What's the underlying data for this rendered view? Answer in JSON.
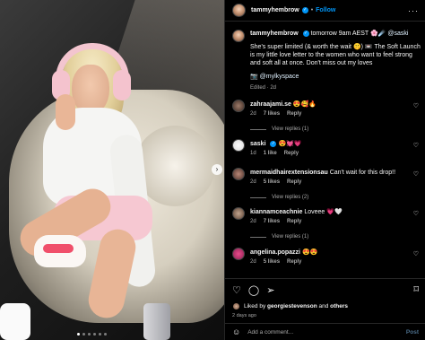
{
  "post": {
    "username": "tammyhembrow",
    "follow_label": "Follow",
    "more_icon": "more-options-icon",
    "separator": "•"
  },
  "caption": {
    "username": "tammyhembrow",
    "intro": "tomorrow 9am AEST 🌸☄️",
    "handle": "@saski",
    "body": "She's super limited (& worth the wait 🤫) 📼 The Soft Launch is my little love letter to the women who want to feel strong and soft all at once. Don't miss out my loves",
    "tag": "📷 @mylkyspace",
    "meta": "Edited · 2d"
  },
  "comments": [
    {
      "username": "zahraajami.se",
      "text": "😍🥰🔥",
      "time": "2d",
      "likes": "7 likes",
      "reply": "Reply",
      "view_replies": "View replies (1)"
    },
    {
      "username": "saski",
      "text": "😍💓💗",
      "time": "1d",
      "likes": "1 like",
      "reply": "Reply"
    },
    {
      "username": "mermaidhairextensionsau",
      "text": "Can't wait for this drop!!",
      "time": "2d",
      "likes": "5 likes",
      "reply": "Reply",
      "view_replies": "View replies (2)"
    },
    {
      "username": "kiannamceachnie",
      "text": "Loveee 💗🤍",
      "time": "2d",
      "likes": "7 likes",
      "reply": "Reply",
      "view_replies": "View replies (1)"
    },
    {
      "username": "angelina.popazzi",
      "text": "😍😍",
      "time": "2d",
      "likes": "5 likes",
      "reply": "Reply"
    }
  ],
  "actions": {
    "like_icon": "heart-icon",
    "comment_icon": "comment-icon",
    "share_icon": "share-icon",
    "save_icon": "bookmark-icon"
  },
  "likes": {
    "prefix": "Liked by",
    "user": "georgiestevenson",
    "and": "and",
    "others": "others"
  },
  "posted_ago": "2 days ago",
  "add_comment": {
    "placeholder": "Add a comment...",
    "post_label": "Post",
    "emoji_icon": "emoji-icon"
  },
  "carousel": {
    "total": 6,
    "active_index": 0
  },
  "colors": {
    "link_blue": "#0095f6",
    "background": "#000000",
    "muted_text": "#a8a8a8"
  }
}
